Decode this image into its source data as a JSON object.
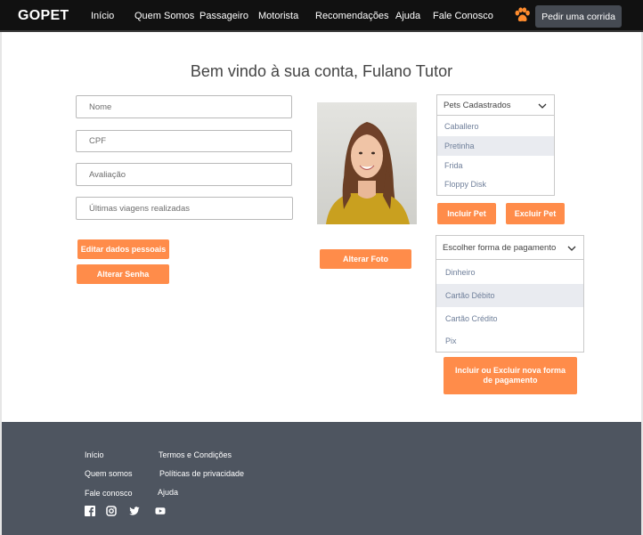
{
  "navbar": {
    "brand": "GOPET",
    "links": [
      "Início",
      "Quem Somos",
      "Passageiro",
      "Motorista",
      "Recomendações",
      "Ajuda",
      "Fale Conosco"
    ],
    "paw_icon": "paw-icon",
    "cta_label": "Pedir uma corrida"
  },
  "main": {
    "welcome": "Bem vindo à sua conta, Fulano Tutor",
    "fields": {
      "nome": "Nome",
      "cpf": "CPF",
      "avaliacao": "Avaliação",
      "viagens": "Últimas viagens realizadas"
    },
    "buttons": {
      "editar": "Editar dados pessoais",
      "senha": "Alterar Senha",
      "foto": "Alterar Foto",
      "incluir_pet": "Incluir Pet",
      "excluir_pet": "Excluir Pet",
      "pagamento": "Incluir ou Excluir nova forma de pagamento"
    },
    "pets": {
      "header": "Pets Cadastrados",
      "items": [
        "Caballero",
        "Pretinha",
        "Frida",
        "Floppy Disk"
      ],
      "selected": "Pretinha"
    },
    "payment": {
      "header": "Escolher forma de pagamento",
      "items": [
        "Dinheiro",
        "Cartão Débito",
        "Cartão Crédito",
        "Pix"
      ],
      "selected": "Cartão Débito"
    }
  },
  "footer": {
    "col1": [
      "Início",
      "Quem somos",
      "Fale conosco"
    ],
    "col2": [
      "Termos e Condições",
      "Políticas de privacidade",
      "Ajuda"
    ],
    "social_icons": [
      "facebook-icon",
      "instagram-icon",
      "twitter-icon",
      "youtube-icon"
    ]
  },
  "colors": {
    "accent": "#ff8c4a",
    "navbar_bg": "#111111",
    "footer_bg": "#4e5560",
    "cta_bg": "#454a52",
    "selected_item_bg": "#e9ebf0"
  }
}
